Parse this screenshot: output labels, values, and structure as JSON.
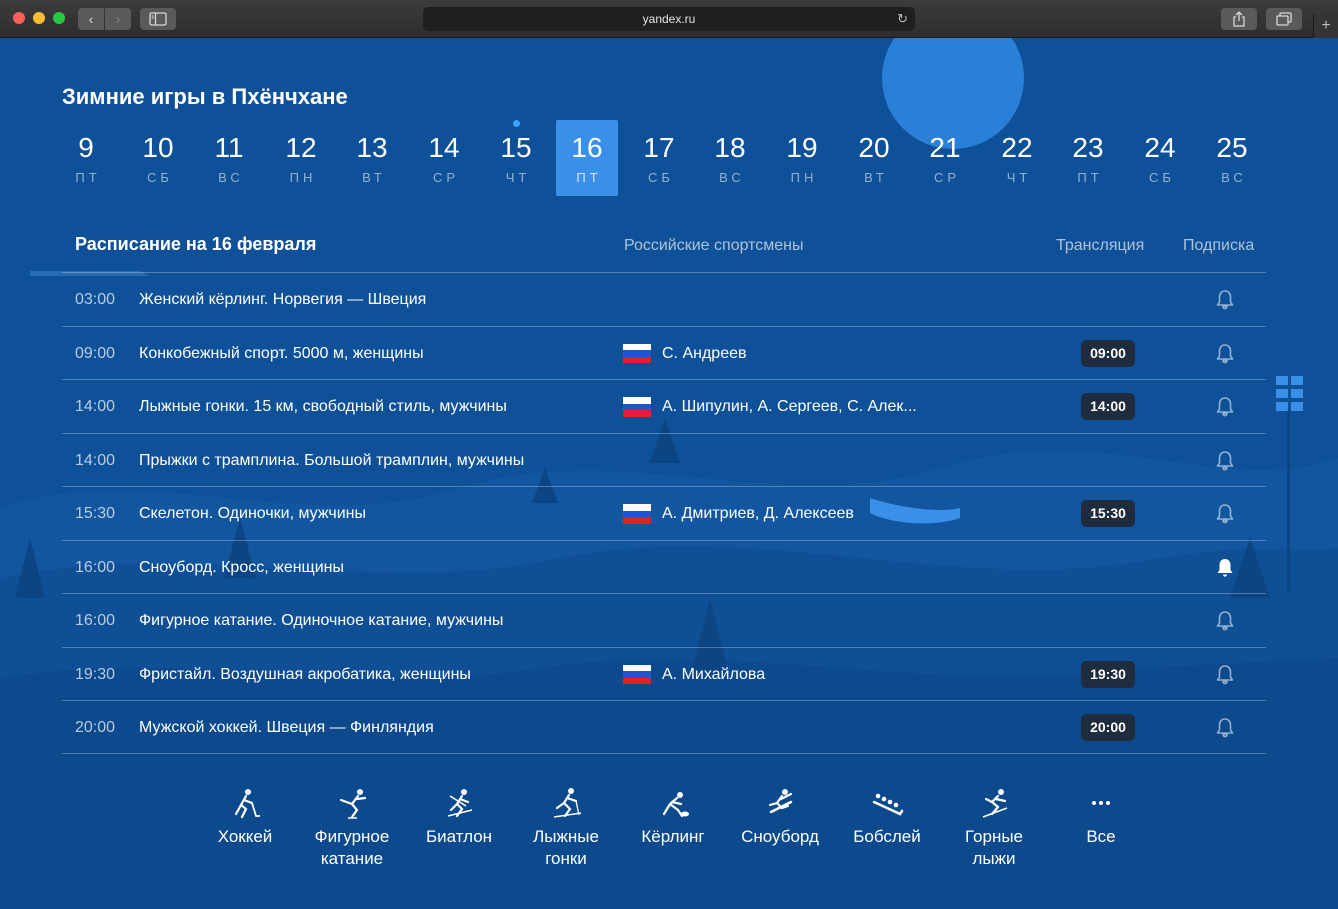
{
  "browser": {
    "url": "yandex.ru",
    "back_glyph": "‹",
    "forward_glyph": "›",
    "reload_glyph": "↻",
    "plus_glyph": "+"
  },
  "page": {
    "title": "Зимние игры в Пхёнчхане",
    "dates": [
      {
        "num": "9",
        "dow": "ПТ"
      },
      {
        "num": "10",
        "dow": "СБ"
      },
      {
        "num": "11",
        "dow": "ВС"
      },
      {
        "num": "12",
        "dow": "ПН"
      },
      {
        "num": "13",
        "dow": "ВТ"
      },
      {
        "num": "14",
        "dow": "СР"
      },
      {
        "num": "15",
        "dow": "ЧТ"
      },
      {
        "num": "16",
        "dow": "ПТ"
      },
      {
        "num": "17",
        "dow": "СБ"
      },
      {
        "num": "18",
        "dow": "ВС"
      },
      {
        "num": "19",
        "dow": "ПН"
      },
      {
        "num": "20",
        "dow": "ВТ"
      },
      {
        "num": "21",
        "dow": "СР"
      },
      {
        "num": "22",
        "dow": "ЧТ"
      },
      {
        "num": "23",
        "dow": "ПТ"
      },
      {
        "num": "24",
        "dow": "СБ"
      },
      {
        "num": "25",
        "dow": "ВС"
      }
    ],
    "selected_date": "16",
    "today_date": "15"
  },
  "schedule": {
    "title": "Расписание на 16 февраля",
    "col_athletes": "Российские спортсмены",
    "col_broadcast": "Трансляция",
    "col_subscription": "Подписка",
    "rows": [
      {
        "time": "03:00",
        "event": "Женский кёрлинг. Норвегия — Швеция",
        "athletes": "",
        "broadcast": "",
        "subscribed": false
      },
      {
        "time": "09:00",
        "event": "Конкобежный спорт. 5000 м, женщины",
        "athletes": "С. Андреев",
        "broadcast": "09:00",
        "subscribed": false
      },
      {
        "time": "14:00",
        "event": "Лыжные гонки. 15 км, свободный стиль, мужчины",
        "athletes": "А. Шипулин, А. Сергеев, С. Алек...",
        "broadcast": "14:00",
        "subscribed": false
      },
      {
        "time": "14:00",
        "event": "Прыжки с трамплина. Большой трамплин, мужчины",
        "athletes": "",
        "broadcast": "",
        "subscribed": false
      },
      {
        "time": "15:30",
        "event": "Скелетон. Одиночки, мужчины",
        "athletes": "А. Дмитриев, Д. Алексеев",
        "broadcast": "15:30",
        "subscribed": false
      },
      {
        "time": "16:00",
        "event": "Сноуборд. Кросс, женщины",
        "athletes": "",
        "broadcast": "",
        "subscribed": true
      },
      {
        "time": "16:00",
        "event": "Фигурное катание. Одиночное катание, мужчины",
        "athletes": "",
        "broadcast": "",
        "subscribed": false
      },
      {
        "time": "19:30",
        "event": "Фристайл. Воздушная акробатика, женщины",
        "athletes": "А. Михайлова",
        "broadcast": "19:30",
        "subscribed": false
      },
      {
        "time": "20:00",
        "event": "Мужской хоккей. Швеция — Финляндия",
        "athletes": "",
        "broadcast": "20:00",
        "subscribed": false
      }
    ]
  },
  "sports": [
    {
      "label": "Хоккей",
      "icon": "hockey-icon"
    },
    {
      "label": "Фигурное катание",
      "icon": "figure-skating-icon"
    },
    {
      "label": "Биатлон",
      "icon": "biathlon-icon"
    },
    {
      "label": "Лыжные гонки",
      "icon": "cross-country-skiing-icon"
    },
    {
      "label": "Кёрлинг",
      "icon": "curling-icon"
    },
    {
      "label": "Сноуборд",
      "icon": "snowboard-icon"
    },
    {
      "label": "Бобслей",
      "icon": "bobsleigh-icon"
    },
    {
      "label": "Горные лыжи",
      "icon": "alpine-skiing-icon"
    },
    {
      "label": "Все",
      "icon": "more-icon"
    }
  ],
  "colors": {
    "background": "#0e5198",
    "selected_date": "#3a8fe8",
    "broadcast_badge": "#1f2c3e",
    "flag_white": "#ffffff",
    "flag_blue": "#1c57c9",
    "flag_red": "#e2202b"
  }
}
